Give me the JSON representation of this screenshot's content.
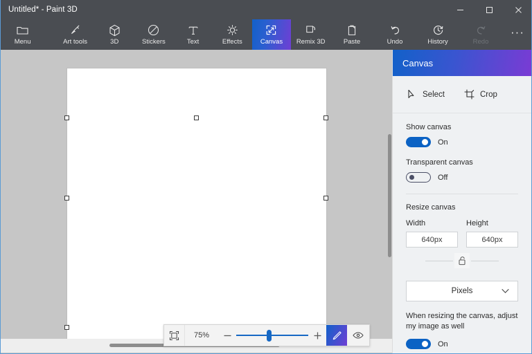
{
  "window": {
    "title": "Untitled* - Paint 3D",
    "controls": {
      "minimize": "minimize-icon",
      "maximize": "maximize-icon",
      "close": "close-icon"
    }
  },
  "ribbon": {
    "items": [
      {
        "label": "Menu",
        "icon": "folder-icon",
        "active": false,
        "disabled": false
      },
      {
        "label": "Art tools",
        "icon": "brush-icon",
        "active": false,
        "disabled": false
      },
      {
        "label": "3D",
        "icon": "cube-icon",
        "active": false,
        "disabled": false
      },
      {
        "label": "Stickers",
        "icon": "sticker-icon",
        "active": false,
        "disabled": false
      },
      {
        "label": "Text",
        "icon": "text-icon",
        "active": false,
        "disabled": false
      },
      {
        "label": "Effects",
        "icon": "effects-icon",
        "active": false,
        "disabled": false
      },
      {
        "label": "Canvas",
        "icon": "canvas-icon",
        "active": true,
        "disabled": false
      },
      {
        "label": "Remix 3D",
        "icon": "remix3d-icon",
        "active": false,
        "disabled": false
      },
      {
        "label": "Paste",
        "icon": "paste-icon",
        "active": false,
        "disabled": false
      },
      {
        "label": "Undo",
        "icon": "undo-icon",
        "active": false,
        "disabled": false
      },
      {
        "label": "History",
        "icon": "history-icon",
        "active": false,
        "disabled": false
      },
      {
        "label": "Redo",
        "icon": "redo-icon",
        "active": false,
        "disabled": true
      }
    ],
    "more_label": "···"
  },
  "zoombar": {
    "fit_icon": "fit-to-screen-icon",
    "percent": "75%",
    "minus": "−",
    "plus": "+",
    "pencil_icon": "pencil-icon",
    "eye_icon": "eye-icon",
    "slider_value": 42
  },
  "panel": {
    "title": "Canvas",
    "tools": [
      {
        "label": "Select",
        "icon": "cursor-arrow-icon"
      },
      {
        "label": "Crop",
        "icon": "crop-icon"
      }
    ],
    "show_canvas": {
      "label": "Show canvas",
      "state": "On",
      "on": true
    },
    "transparent_canvas": {
      "label": "Transparent canvas",
      "state": "Off",
      "on": false
    },
    "resize": {
      "title": "Resize canvas",
      "width_label": "Width",
      "width_value": "640px",
      "height_label": "Height",
      "height_value": "640px",
      "lock_icon": "unlocked-padlock-icon",
      "unit_value": "Pixels",
      "unit_chevron": "chevron-down-icon"
    },
    "adjust": {
      "label": "When resizing the canvas, adjust my image as well",
      "state": "On",
      "on": true
    }
  },
  "colors": {
    "titlebar_bg": "#4a4d52",
    "accent_blue": "#1261c9",
    "accent_purple": "#6f3fd4",
    "canvas_bg": "#c6c6c6",
    "panel_bg": "#eff1f3",
    "toggle_on": "#0b62c4"
  }
}
